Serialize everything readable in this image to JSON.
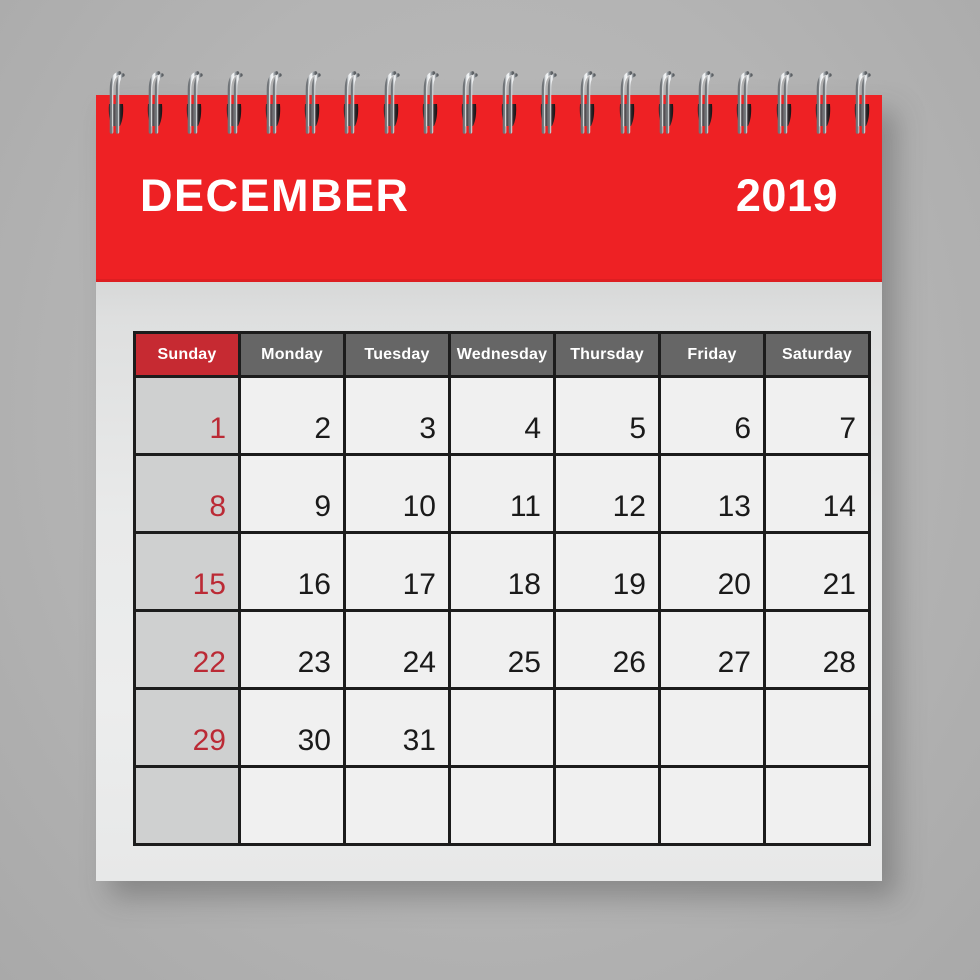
{
  "calendar": {
    "month": "DECEMBER",
    "year": "2019",
    "colors": {
      "banner_red": "#EE2124",
      "sunday_header_red": "#C62A32",
      "weekday_header_gray": "#666666",
      "sunday_number_red": "#BB2A35",
      "page_background": "#B5B5B5",
      "paper": "#ECEDED",
      "cell": "#F0F0F0",
      "sunday_cell": "#CFD0D0",
      "grid_line": "#1C1C1C"
    },
    "weekday_headers": [
      {
        "label": "Sunday",
        "highlight": true
      },
      {
        "label": "Monday",
        "highlight": false
      },
      {
        "label": "Tuesday",
        "highlight": false
      },
      {
        "label": "Wednesday",
        "highlight": false
      },
      {
        "label": "Thursday",
        "highlight": false
      },
      {
        "label": "Friday",
        "highlight": false
      },
      {
        "label": "Saturday",
        "highlight": false
      }
    ],
    "weeks": [
      [
        "1",
        "2",
        "3",
        "4",
        "5",
        "6",
        "7"
      ],
      [
        "8",
        "9",
        "10",
        "11",
        "12",
        "13",
        "14"
      ],
      [
        "15",
        "16",
        "17",
        "18",
        "19",
        "20",
        "21"
      ],
      [
        "22",
        "23",
        "24",
        "25",
        "26",
        "27",
        "28"
      ],
      [
        "29",
        "30",
        "31",
        "",
        "",
        "",
        ""
      ],
      [
        "",
        "",
        "",
        "",
        "",
        "",
        ""
      ]
    ],
    "binding": {
      "icon": "spiral-wire-icon",
      "coil_count": 20
    }
  }
}
